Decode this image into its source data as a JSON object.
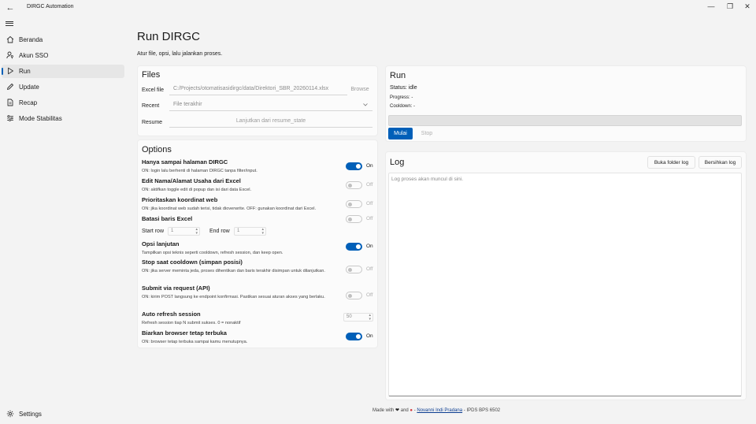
{
  "window": {
    "title": "DIRGC Automation",
    "back_icon": "←",
    "minimize_icon": "—",
    "maximize_icon": "❐",
    "close_icon": "✕"
  },
  "sidebar": {
    "items": [
      {
        "label": "Beranda",
        "icon": "home-icon"
      },
      {
        "label": "Akun SSO",
        "icon": "user-key-icon"
      },
      {
        "label": "Run",
        "icon": "play-icon"
      },
      {
        "label": "Update",
        "icon": "pencil-icon"
      },
      {
        "label": "Recap",
        "icon": "document-icon"
      },
      {
        "label": "Mode Stabilitas",
        "icon": "sliders-icon"
      }
    ],
    "settings_label": "Settings"
  },
  "page": {
    "title": "Run DIRGC",
    "subtitle": "Atur file, opsi, lalu jalankan proses."
  },
  "files": {
    "title": "Files",
    "excel_label": "Excel file",
    "excel_value": "C:/Projects/otomatisasidirgc/data/Direktori_SBR_20260114.xlsx",
    "browse_label": "Browse",
    "recent_label": "Recent",
    "recent_value": "File terakhir",
    "resume_label": "Resume",
    "resume_button": "Lanjutkan dari resume_state"
  },
  "options": {
    "title": "Options",
    "items": [
      {
        "title": "Hanya sampai halaman DIRGC",
        "desc": "ON: login lalu berhenti di halaman DIRGC tanpa filter/input.",
        "state": "On"
      },
      {
        "title": "Edit Nama/Alamat Usaha dari Excel",
        "desc": "ON: aktifkan toggle edit di popup dan isi dari data Excel.",
        "state": "Off"
      },
      {
        "title": "Prioritaskan koordinat web",
        "desc": "ON: jika koordinat web sudah terisi, tidak dioverwrite. OFF: gunakan koordinat dari Excel.",
        "state": "Off"
      },
      {
        "title": "Batasi baris Excel",
        "desc": "",
        "state": "Off"
      },
      {
        "title": "Opsi lanjutan",
        "desc": "Tampilkan opsi teknis seperti cooldown, refresh session, dan keep open.",
        "state": "On"
      },
      {
        "title": "Stop saat cooldown (simpan posisi)",
        "desc": "ON: jika server meminta jeda, proses dihentikan dan baris terakhir disimpan untuk dilanjutkan.",
        "state": "Off"
      },
      {
        "title": "Submit via request (API)",
        "desc": "ON: kirim POST langsung ke endpoint konfirmasi. Pastikan sesuai aturan akses yang berlaku.",
        "state": "Off"
      },
      {
        "title": "Auto refresh session",
        "desc": "Refresh session tiap N submit sukses. 0 = nonaktif",
        "state": ""
      },
      {
        "title": "Biarkan browser tetap terbuka",
        "desc": "ON: browser tetap terbuka sampai kamu menutupnya.",
        "state": "On"
      }
    ],
    "start_row_label": "Start row",
    "start_row_value": "1",
    "end_row_label": "End row",
    "end_row_value": "1",
    "refresh_value": "50"
  },
  "run": {
    "title": "Run",
    "status": "Status: idle",
    "progress": "Progress: -",
    "cooldown": "Cooldown: -",
    "progress_fraction": 0,
    "start_button": "Mulai",
    "stop_button": "Stop"
  },
  "log": {
    "title": "Log",
    "open_folder_button": "Buka folder log",
    "clear_button": "Bersihkan log",
    "placeholder": "Log proses akan muncul di sini."
  },
  "footer": {
    "made_with": "Made with",
    "heart": "❤",
    "and": "and",
    "tomato": "●",
    "dash": "-",
    "author": "Novanni Indi Pradana",
    "org": "- IPDS BPS 6502"
  },
  "colors": {
    "accent": "#005fb8",
    "background": "#f3f3f3",
    "card": "#fbfbfb"
  }
}
